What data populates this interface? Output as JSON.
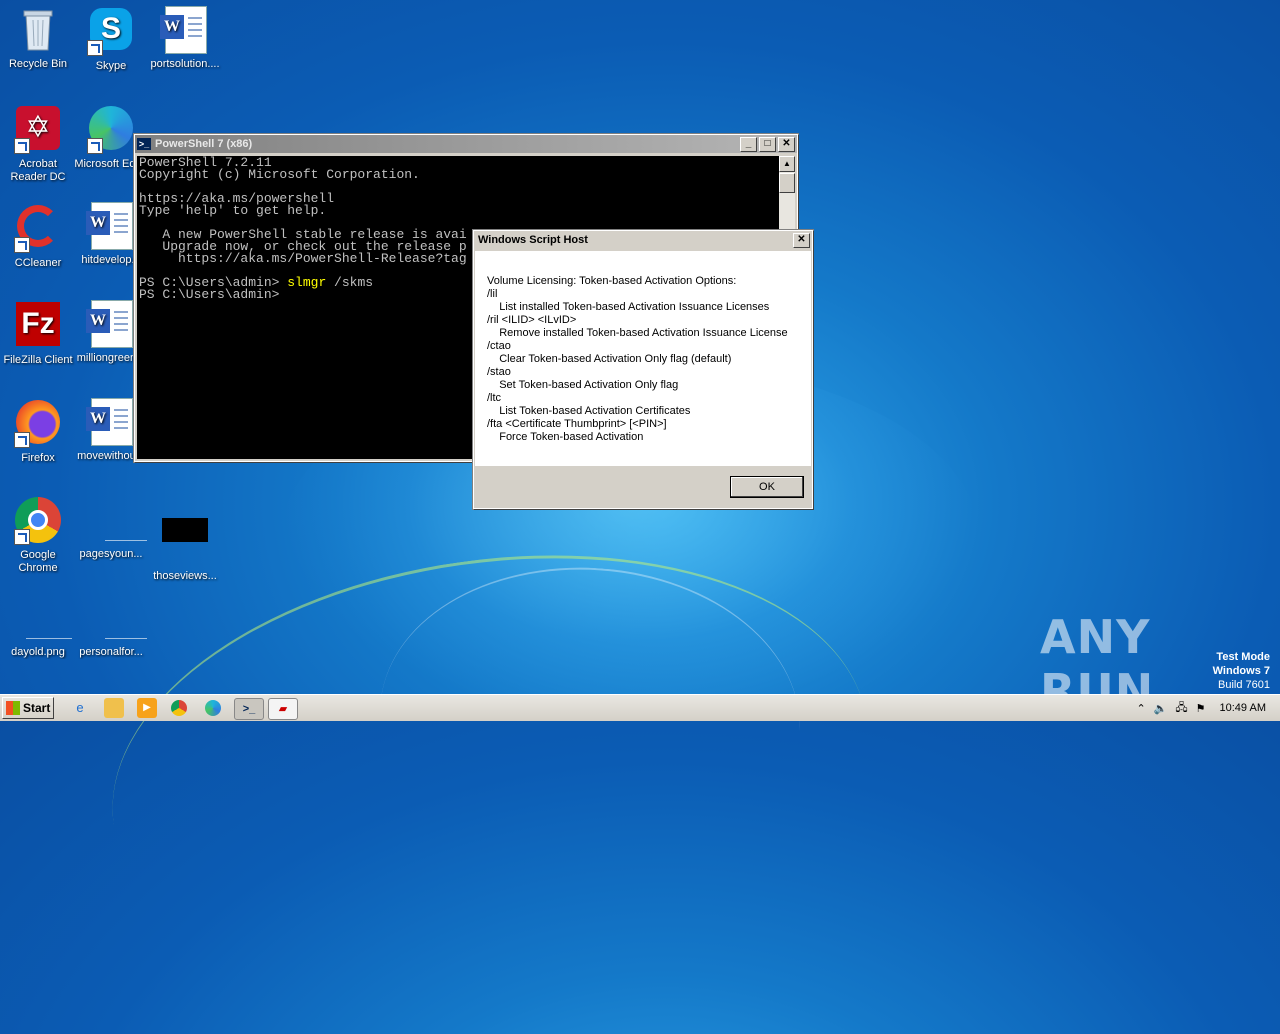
{
  "desktop": {
    "icons": [
      {
        "label": "Recycle Bin"
      },
      {
        "label": "Skype"
      },
      {
        "label": "portsolution...."
      },
      {
        "label": "Acrobat Reader DC"
      },
      {
        "label": "Microsoft Edge"
      },
      {
        "label": "CCleaner"
      },
      {
        "label": "hitdevelop..."
      },
      {
        "label": "FileZilla Client"
      },
      {
        "label": "milliongreen..."
      },
      {
        "label": "Firefox"
      },
      {
        "label": "movewithou..."
      },
      {
        "label": "Google Chrome"
      },
      {
        "label": "pagesyoun..."
      },
      {
        "label": "thoseviews..."
      },
      {
        "label": "dayold.png"
      },
      {
        "label": "personalfor..."
      }
    ]
  },
  "powershell": {
    "title": "PowerShell 7 (x86)",
    "lines": [
      "PowerShell 7.2.11",
      "Copyright (c) Microsoft Corporation.",
      "",
      "https://aka.ms/powershell",
      "Type 'help' to get help.",
      "",
      "   A new PowerShell stable release is avai",
      "   Upgrade now, or check out the release p",
      "     https://aka.ms/PowerShell-Release?tag",
      ""
    ],
    "prompt1": "PS C:\\Users\\admin> ",
    "command": "slmgr",
    "command_args": " /skms",
    "prompt2": "PS C:\\Users\\admin>"
  },
  "dialog": {
    "title": "Windows Script Host",
    "lines": [
      "Volume Licensing: Token-based Activation Options:",
      "/lil",
      "    List installed Token-based Activation Issuance Licenses",
      "/ril <ILID> <ILvID>",
      "    Remove installed Token-based Activation Issuance License",
      "/ctao",
      "    Clear Token-based Activation Only flag (default)",
      "/stao",
      "    Set Token-based Activation Only flag",
      "/ltc",
      "    List Token-based Activation Certificates",
      "/fta <Certificate Thumbprint> [<PIN>]",
      "    Force Token-based Activation"
    ],
    "ok_label": "OK"
  },
  "taskbar": {
    "start_label": "Start",
    "clock": "10:49 AM"
  },
  "watermark": {
    "line1": "Test Mode",
    "line2": "Windows 7",
    "line3": "Build 7601",
    "brand": "ANY RUN"
  },
  "colors": {
    "desktop": "#0b5cb4",
    "console_bg": "#000000",
    "console_fg": "#c0c0c0",
    "command_highlight": "#ffff00",
    "dialog_title": "#0a246a"
  }
}
